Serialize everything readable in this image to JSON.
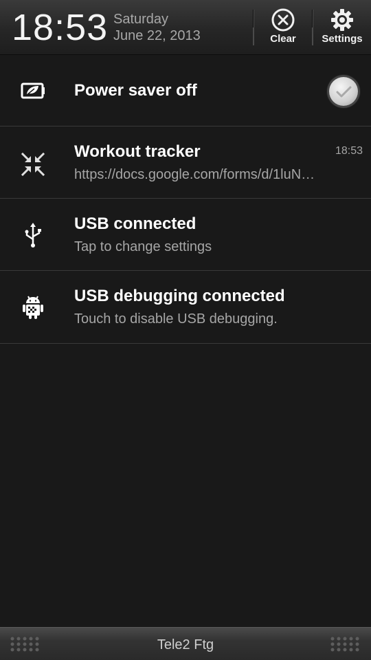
{
  "header": {
    "time": "18:53",
    "weekday": "Saturday",
    "date": "June 22, 2013",
    "clear_label": "Clear",
    "settings_label": "Settings"
  },
  "notifications": [
    {
      "title": "Power saver off",
      "subtitle": "",
      "time": "",
      "icon": "power-saver-icon"
    },
    {
      "title": "Workout tracker",
      "subtitle": "https://docs.google.com/forms/d/1luN…",
      "time": "18:53",
      "icon": "arrows-inward-icon"
    },
    {
      "title": "USB connected",
      "subtitle": "Tap to change settings",
      "time": "",
      "icon": "usb-icon"
    },
    {
      "title": "USB debugging connected",
      "subtitle": "Touch to disable USB debugging.",
      "time": "",
      "icon": "android-debug-icon"
    }
  ],
  "footer": {
    "carrier": "Tele2 Ftg"
  },
  "colors": {
    "background": "#191919",
    "text_primary": "#ffffff",
    "text_secondary": "#a6a6a6"
  }
}
